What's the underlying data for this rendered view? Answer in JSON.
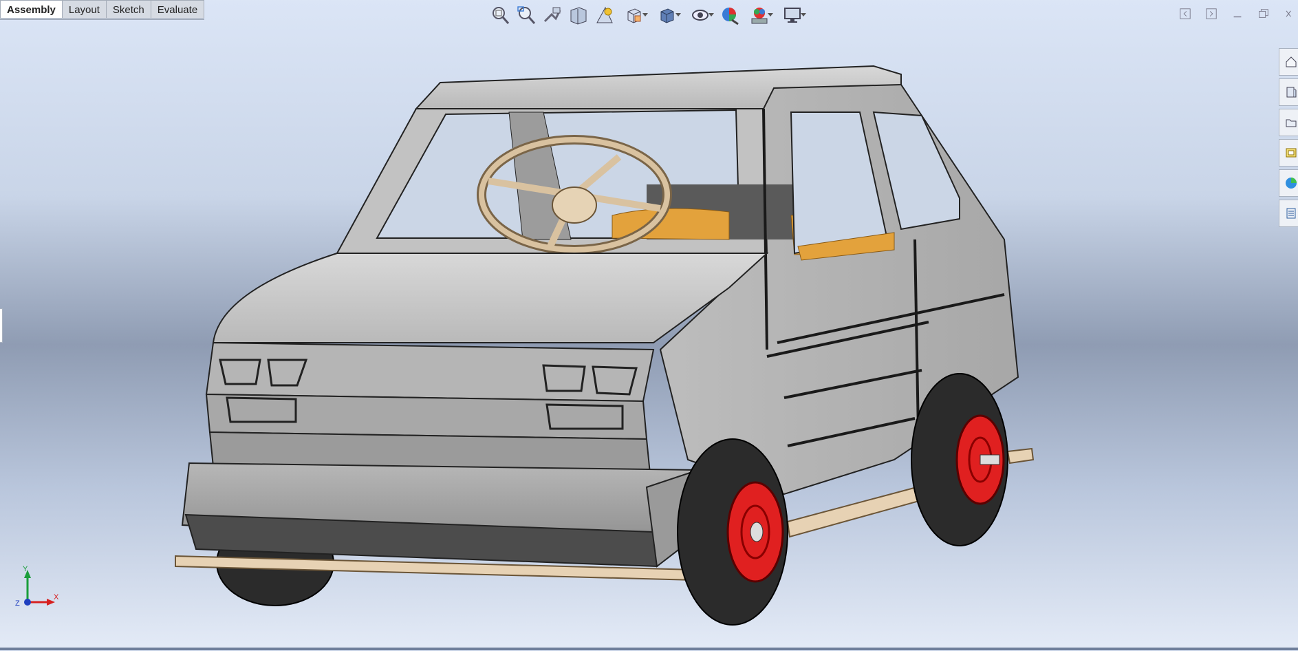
{
  "command_manager": {
    "tabs": [
      {
        "label": "Assembly",
        "active": true
      },
      {
        "label": "Layout",
        "active": false
      },
      {
        "label": "Sketch",
        "active": false
      },
      {
        "label": "Evaluate",
        "active": false
      }
    ]
  },
  "heads_up_toolbar": {
    "icons": [
      "zoom-to-fit-icon",
      "zoom-to-area-icon",
      "previous-view-icon",
      "section-view-icon",
      "dynamic-annotation-icon",
      "view-orientation-icon",
      "display-style-icon",
      "hide-show-items-icon",
      "edit-appearance-icon",
      "apply-scene-icon",
      "view-settings-icon"
    ]
  },
  "window_controls": {
    "icons": [
      "tile-left-icon",
      "tile-right-icon",
      "minimize-icon",
      "restore-icon",
      "close-icon"
    ]
  },
  "task_pane": {
    "icons": [
      "home-icon",
      "design-library-icon",
      "file-explorer-icon",
      "view-palette-icon",
      "appearances-icon",
      "custom-properties-icon"
    ]
  },
  "model": {
    "description_hidden": true,
    "colors": {
      "body": "#a9a9a9",
      "wheel_rim": "#e02020",
      "tire": "#2b2b2b",
      "wood": "#e7d2b4",
      "seat": "#e3a23c"
    }
  },
  "triad": {
    "x_label": "X",
    "y_label": "Y",
    "z_label": "Z",
    "x_color": "#d62020",
    "y_color": "#1a9e3a",
    "z_color": "#1f3fbf"
  }
}
